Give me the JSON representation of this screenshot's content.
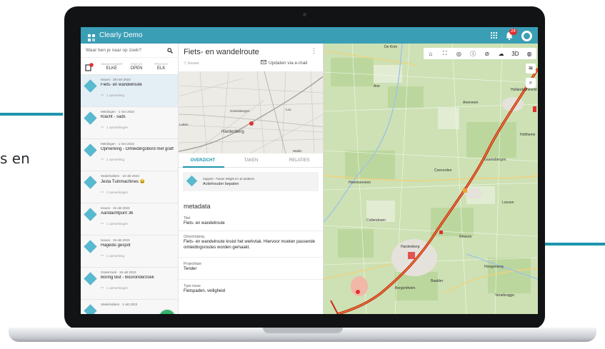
{
  "colors": {
    "brand_teal": "#3a9eb5",
    "accent_teal": "#1e95ad",
    "fab_green": "#34b36b",
    "badge_red": "#e0302f",
    "item_icon": "#58b9cf",
    "road_red": "#c62b1d",
    "map_green": "#c9dfb0"
  },
  "background": {
    "side_text": "s en"
  },
  "app": {
    "title": "Clearly Demo",
    "logo_icon": "grid-logo-icon",
    "notification_count": "24"
  },
  "list": {
    "search_placeholder": "Waar ben je naar op zoek?",
    "filters": [
      {
        "label": "TAAKHOUDER",
        "value": "ELKE"
      },
      {
        "label": "STATUS",
        "value": "OPEN"
      },
      {
        "label": "PROCES",
        "value": "ELK"
      }
    ],
    "items": [
      {
        "head": "Issues · 29 mei 2023",
        "title": "Fiets- en wandelroute",
        "sub": "1 opmerking"
      },
      {
        "head": "Meldingen · 1 mei 2023",
        "title": "Klacht - sads",
        "sub": "1 opmerkingen"
      },
      {
        "head": "Meldingen · 1 mei 2023",
        "title": "Opmerking - Omleidingsbord met graffiti bes...",
        "sub": "1 opmerking"
      },
      {
        "head": "Stakeholders · 19 okt 2023",
        "title": "Jesta Tuinmachines 😀",
        "sub": "2 opmerkingen"
      },
      {
        "head": "Issues · 19 okt 2023",
        "title": "Aandachtpunt 36",
        "sub": "1 opmerkingen"
      },
      {
        "head": "Issues · 19 okt 2023",
        "title": "Hagedis gespot",
        "sub": "1 opmerking"
      },
      {
        "head": "Onderzoek · 19 okt 2023",
        "title": "Boring test - Booronderzoek",
        "sub": "1 opmerkingen"
      },
      {
        "head": "Stakeholders · 2 okt 2023",
        "title": "",
        "sub": ""
      }
    ],
    "fab_label": "+"
  },
  "detail": {
    "title": "Fiets- en wandelroute",
    "subtitle": "Issues",
    "update_link": "Updaten via e-mail",
    "mini_map_labels": [
      "Gramsbergen",
      "Loo",
      "Hardenberg",
      "Wadin",
      "Lutten"
    ],
    "tabs": [
      "OVERZICHT",
      "TAKEN",
      "RELATIES"
    ],
    "note": {
      "head": "Support - Future Insight en 10 anderen",
      "text": "Actiehouder bepalen"
    },
    "section_title": "metadata",
    "fields": [
      {
        "label": "Titel",
        "value": "Fiets- en wandelroute"
      },
      {
        "label": "Omschrijving",
        "value": "Fiets- en wandelroute kruist het werkvlak. Hiervoor moeten passende omleidingsroutes worden gemaakt."
      },
      {
        "label": "Projectfase",
        "value": "Tender"
      },
      {
        "label": "Type issue",
        "value": "Fietspaden, veiligheid"
      }
    ]
  },
  "map": {
    "toolbar": [
      "⌂",
      "⛶",
      "◎",
      "ⓘ",
      "⊘",
      "☁",
      "3D",
      "◍"
    ],
    "side_buttons": [
      "≋",
      "⌕"
    ],
    "labels": [
      {
        "text": "De Krim"
      },
      {
        "text": "Hollandscheveld"
      },
      {
        "text": "Ane"
      },
      {
        "text": "Anerveen"
      },
      {
        "text": "Holtheme"
      },
      {
        "text": "Gramsbergen"
      },
      {
        "text": "Loozen"
      },
      {
        "text": "Coevorden"
      },
      {
        "text": "Collendoorn"
      },
      {
        "text": "Hardenberg"
      },
      {
        "text": "Heemserveen"
      },
      {
        "text": "Bergentheim"
      },
      {
        "text": "Hoogenweg"
      },
      {
        "text": "Venebrugge"
      },
      {
        "text": "Baalder"
      },
      {
        "text": "Rheeze"
      }
    ]
  }
}
